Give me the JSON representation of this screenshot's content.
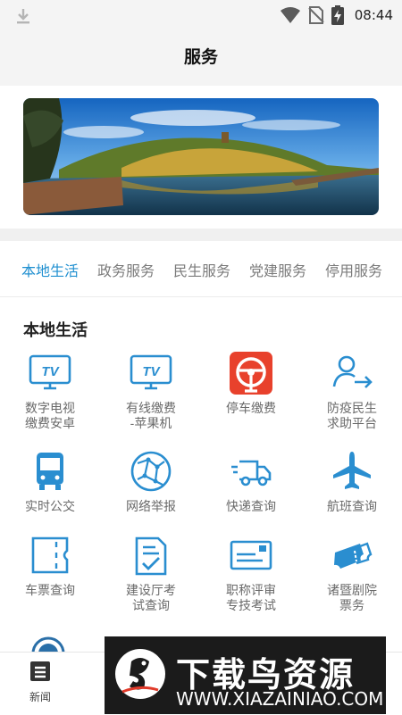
{
  "status_bar": {
    "time": "08:44"
  },
  "header": {
    "title": "服务"
  },
  "tabs": [
    {
      "label": "本地生活",
      "active": true
    },
    {
      "label": "政务服务",
      "active": false
    },
    {
      "label": "民生服务",
      "active": false
    },
    {
      "label": "党建服务",
      "active": false
    },
    {
      "label": "停用服务",
      "active": false
    }
  ],
  "section": {
    "title": "本地生活"
  },
  "grid": [
    {
      "label": "数字电视\n缴费安卓",
      "icon": "tv-icon"
    },
    {
      "label": "有线缴费\n-苹果机",
      "icon": "tv-icon"
    },
    {
      "label": "停车缴费",
      "icon": "parking-icon"
    },
    {
      "label": "防疫民生\n求助平台",
      "icon": "person-arrow-icon"
    },
    {
      "label": "实时公交",
      "icon": "bus-icon"
    },
    {
      "label": "网络举报",
      "icon": "network-globe-icon"
    },
    {
      "label": "快递查询",
      "icon": "delivery-truck-icon"
    },
    {
      "label": "航班查询",
      "icon": "airplane-icon"
    },
    {
      "label": "车票查询",
      "icon": "ticket-icon"
    },
    {
      "label": "建设厅考\n试查询",
      "icon": "clipboard-check-icon"
    },
    {
      "label": "职称评审\n专技考试",
      "icon": "certificate-card-icon"
    },
    {
      "label": "诸暨剧院\n票务",
      "icon": "theater-tickets-icon"
    }
  ],
  "bottom_nav": {
    "news_label": "新闻"
  },
  "watermark": {
    "brand": "下载鸟资源",
    "url": "WWW.XIAZAINIAO.COM"
  },
  "colors": {
    "accent": "#1f8fd0",
    "parking_red": "#e8412c"
  }
}
